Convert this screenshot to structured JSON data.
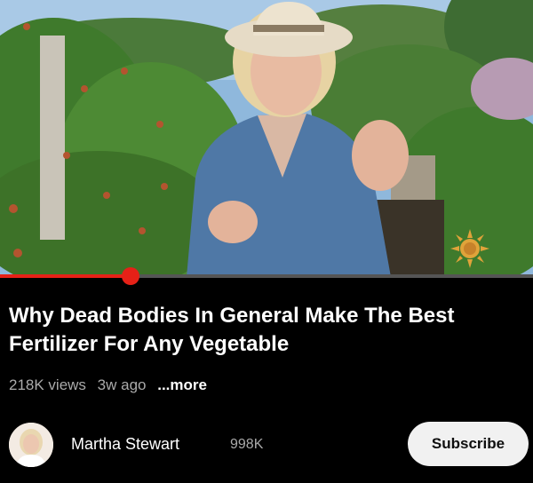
{
  "video": {
    "title": "Why Dead Bodies In General Make The Best Fertilizer For Any Vegetable",
    "progress_fraction": 0.245
  },
  "meta": {
    "views": "218K views",
    "age": "3w ago",
    "more": "...more"
  },
  "channel": {
    "name": "Martha Stewart",
    "subscribers": "998K",
    "subscribe_label": "Subscribe"
  },
  "colors": {
    "accent": "#e62117",
    "background": "#000000",
    "button_bg": "#f1f1f1",
    "secondary_text": "#aaaaaa"
  },
  "icons": {
    "watermark": "sun-logo-icon"
  }
}
